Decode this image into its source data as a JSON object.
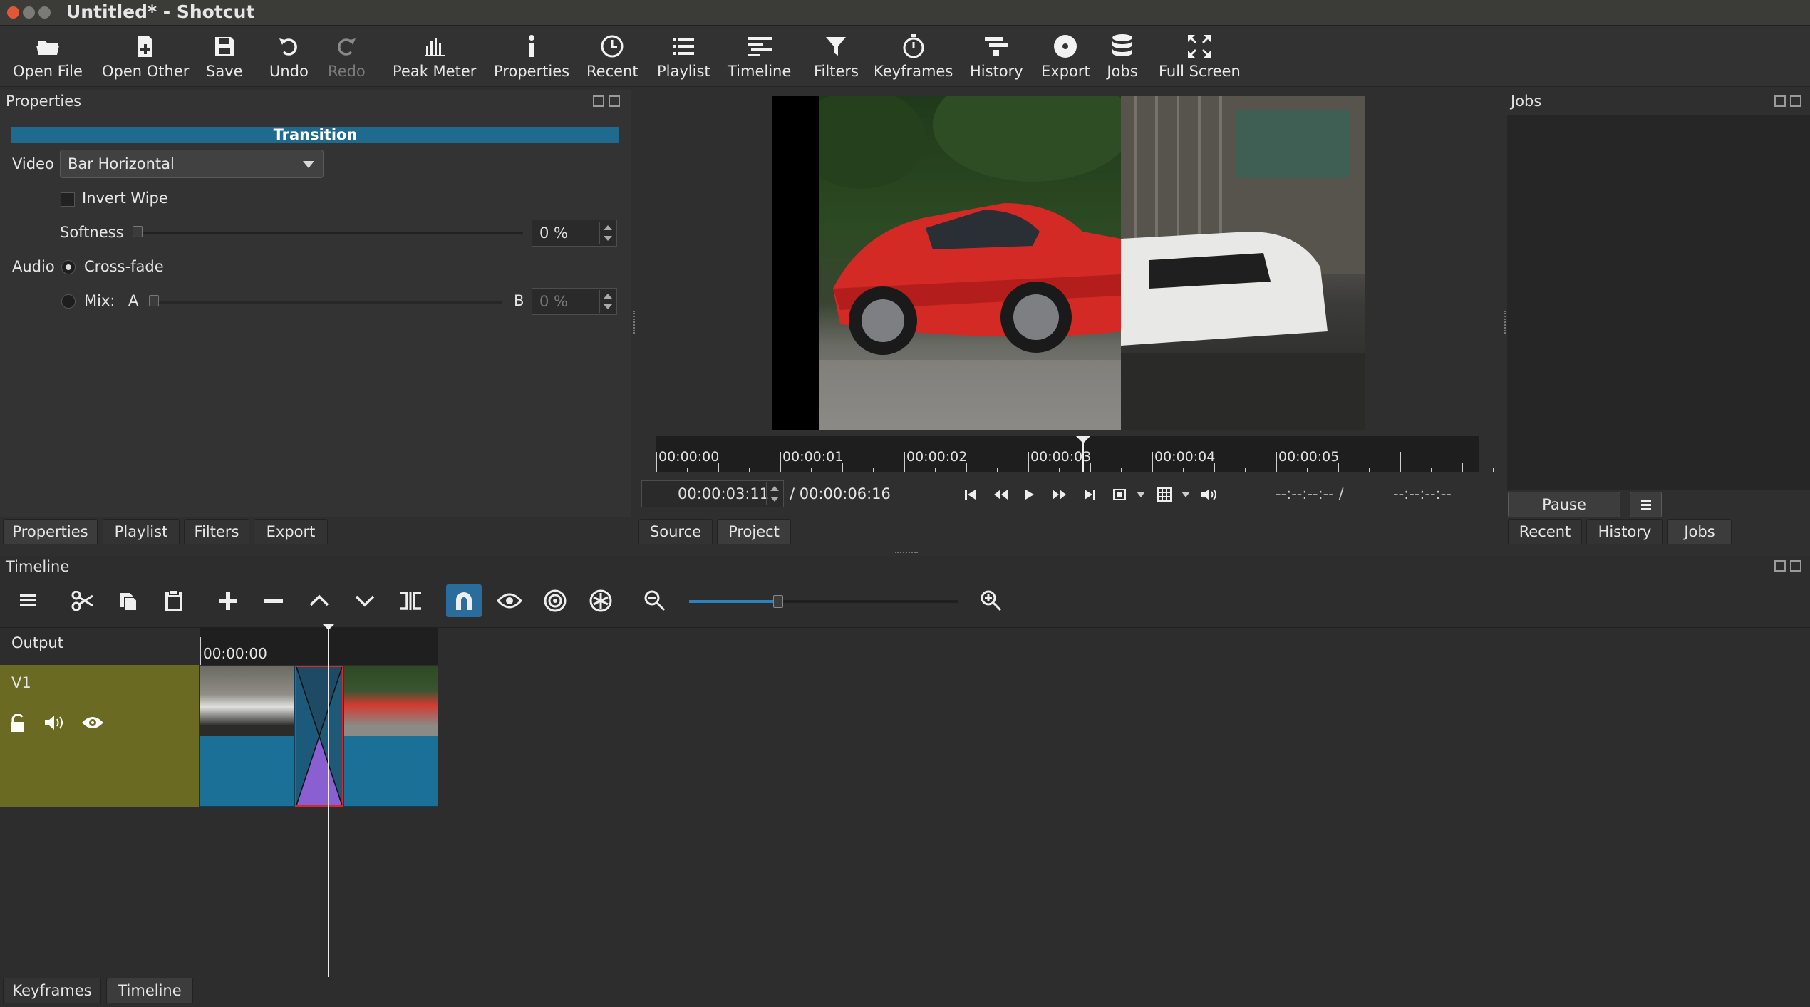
{
  "window": {
    "title": "Untitled* - Shotcut"
  },
  "toolbar": {
    "open_file": "Open File",
    "open_other": "Open Other",
    "save": "Save",
    "undo": "Undo",
    "redo": "Redo",
    "peak_meter": "Peak Meter",
    "properties": "Properties",
    "recent": "Recent",
    "playlist": "Playlist",
    "timeline": "Timeline",
    "filters": "Filters",
    "keyframes": "Keyframes",
    "history": "History",
    "export": "Export",
    "jobs": "Jobs",
    "full_screen": "Full Screen"
  },
  "properties_panel": {
    "title": "Properties",
    "section": "Transition",
    "video_label": "Video",
    "video_value": "Bar Horizontal",
    "invert_wipe": "Invert Wipe",
    "softness_label": "Softness",
    "softness_value": "0 %",
    "softness_level": 0,
    "audio_label": "Audio",
    "crossfade": "Cross-fade",
    "mix_label": "Mix:",
    "mix_a": "A",
    "mix_b": "B",
    "mix_value": "0 %",
    "mix_level": 0,
    "tabs": [
      "Properties",
      "Playlist",
      "Filters",
      "Export"
    ]
  },
  "viewer": {
    "ruler_labels": [
      "00:00:00",
      "00:00:01",
      "00:00:02",
      "00:00:03",
      "00:00:04",
      "00:00:05"
    ],
    "current_time": "00:00:03:11",
    "duration": "/ 00:00:06:16",
    "in_point": "--:--:--:-- /",
    "out_point": "--:--:--:--",
    "tabs": [
      "Source",
      "Project"
    ]
  },
  "jobs_panel": {
    "title": "Jobs",
    "pause": "Pause",
    "tabs": [
      "Recent",
      "History",
      "Jobs"
    ]
  },
  "timeline": {
    "title": "Timeline",
    "output_label": "Output",
    "ruler_start": "00:00:00",
    "track_name": "V1",
    "tabs": [
      "Keyframes",
      "Timeline"
    ],
    "zoom_level": 0.33
  },
  "colors": {
    "accent": "#2a6d9c",
    "transition_header": "#1e6b8f",
    "track_header": "#6b6a23",
    "clip": "#1b7098",
    "transition_clip": "#8a5fd1"
  }
}
